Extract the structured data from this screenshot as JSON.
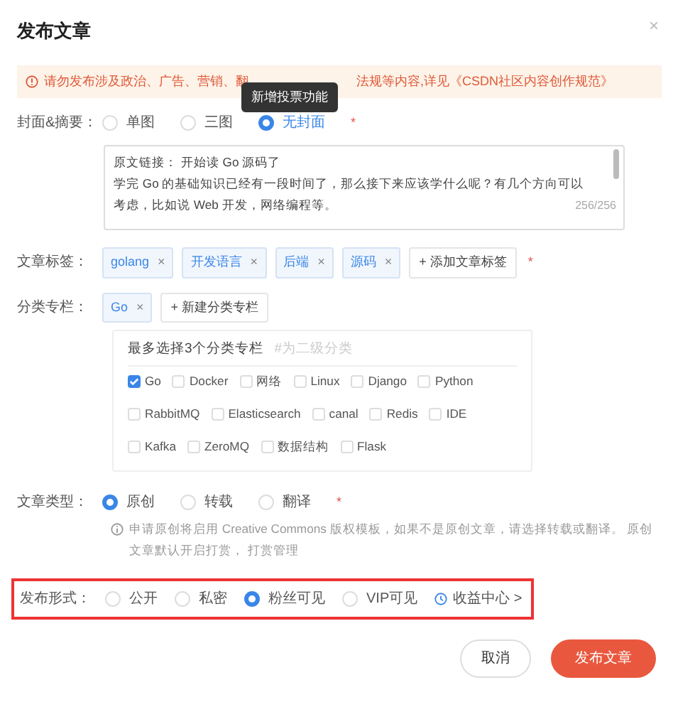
{
  "dialog": {
    "title": "发布文章",
    "close": "×"
  },
  "notice": {
    "text_before": "请勿发布涉及政治、广告、营销、翻",
    "text_after": "法规等内容,",
    "link": "详见《CSDN社区内容创作规范》"
  },
  "tooltip": {
    "text": "新增投票功能"
  },
  "cover": {
    "label": "封面&摘要：",
    "options": [
      {
        "label": "单图",
        "selected": false
      },
      {
        "label": "三图",
        "selected": false
      },
      {
        "label": "无封面",
        "selected": true
      }
    ],
    "required": "*"
  },
  "summary": {
    "lines": [
      "原文链接： 开始读 Go 源码了",
      "学完 Go 的基础知识已经有一段时间了，那么接下来应该学什么呢？有几个方向可以",
      "考虑，比如说 Web 开发，网络编程等。"
    ],
    "counter": "256/256"
  },
  "tags": {
    "label": "文章标签：",
    "remove": "×",
    "items": [
      "golang",
      "开发语言",
      "后端",
      "源码"
    ],
    "add": "+ 添加文章标签",
    "required": "*"
  },
  "category": {
    "label": "分类专栏：",
    "chosen": [
      "Go"
    ],
    "add": "+ 新建分类专栏",
    "hint": "最多选择3个分类专栏",
    "subhint": "#为二级分类",
    "options": [
      {
        "label": "Go",
        "checked": true
      },
      {
        "label": "Docker",
        "checked": false
      },
      {
        "label": "网络",
        "checked": false
      },
      {
        "label": "Linux",
        "checked": false
      },
      {
        "label": "Django",
        "checked": false
      },
      {
        "label": "Python",
        "checked": false
      },
      {
        "label": "RabbitMQ",
        "checked": false
      },
      {
        "label": "Elasticsearch",
        "checked": false
      },
      {
        "label": "canal",
        "checked": false
      },
      {
        "label": "Redis",
        "checked": false
      },
      {
        "label": "IDE",
        "checked": false
      },
      {
        "label": "Kafka",
        "checked": false
      },
      {
        "label": "ZeroMQ",
        "checked": false
      },
      {
        "label": "数据结构",
        "checked": false
      },
      {
        "label": "Flask",
        "checked": false
      }
    ]
  },
  "article_type": {
    "label": "文章类型：",
    "options": [
      {
        "label": "原创",
        "selected": true
      },
      {
        "label": "转载",
        "selected": false
      },
      {
        "label": "翻译",
        "selected": false
      }
    ],
    "required": "*",
    "note_before": "申请原创将启用",
    "note_link": "Creative Commons",
    "note_after": "版权模板，如果不是原创文章，请选择转载或翻译。 原创文章默认开启打赏，",
    "note_link2": "打赏管理"
  },
  "publish_form": {
    "label": "发布形式：",
    "options": [
      {
        "label": "公开",
        "selected": false
      },
      {
        "label": "私密",
        "selected": false
      },
      {
        "label": "粉丝可见",
        "selected": true
      },
      {
        "label": "VIP可见",
        "selected": false
      }
    ],
    "link": "收益中心 >"
  },
  "buttons": [
    {
      "label": "取消",
      "kind": "secondary"
    },
    {
      "label": "发布文章",
      "kind": "primary"
    }
  ]
}
